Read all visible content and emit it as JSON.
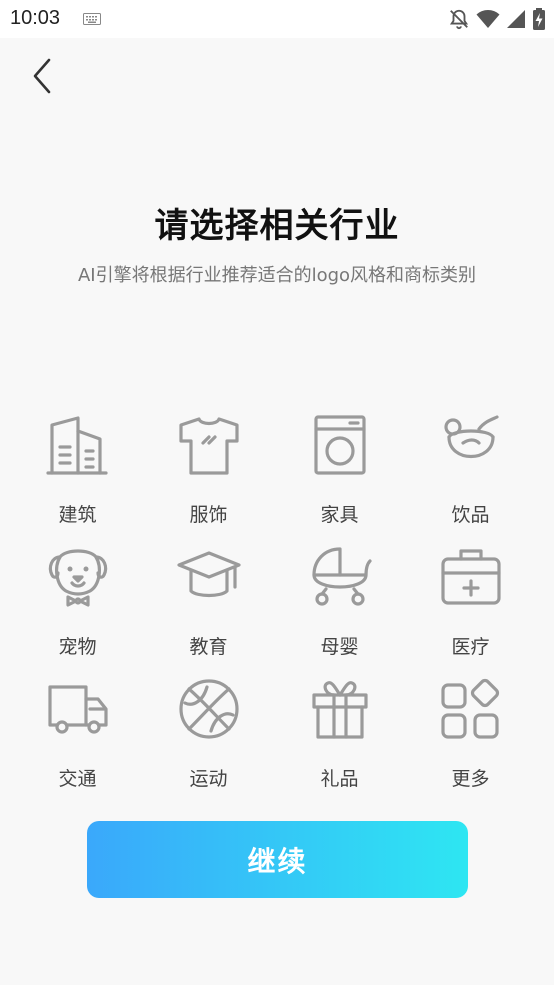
{
  "status_bar": {
    "time": "10:03",
    "icons": [
      "keyboard-icon",
      "bell-off-icon",
      "wifi-icon",
      "cellular-signal-icon",
      "battery-charging-icon"
    ]
  },
  "header": {
    "back_icon": "chevron-left-icon"
  },
  "main": {
    "title": "请选择相关行业",
    "subtitle": "AI引擎将根据行业推荐适合的logo风格和商标类别"
  },
  "industries": [
    {
      "label": "建筑",
      "icon": "building-icon"
    },
    {
      "label": "服饰",
      "icon": "tshirt-icon"
    },
    {
      "label": "家具",
      "icon": "washing-machine-icon"
    },
    {
      "label": "饮品",
      "icon": "drink-cup-icon"
    },
    {
      "label": "宠物",
      "icon": "dog-icon"
    },
    {
      "label": "教育",
      "icon": "graduation-cap-icon"
    },
    {
      "label": "母婴",
      "icon": "baby-stroller-icon"
    },
    {
      "label": "医疗",
      "icon": "medical-kit-icon"
    },
    {
      "label": "交通",
      "icon": "truck-icon"
    },
    {
      "label": "运动",
      "icon": "basketball-icon"
    },
    {
      "label": "礼品",
      "icon": "gift-icon"
    },
    {
      "label": "更多",
      "icon": "more-grid-icon"
    }
  ],
  "continue_button": {
    "label": "继续"
  },
  "colors": {
    "background": "#f8f8f8",
    "icon_gray": "#9a9a9a",
    "gradient_start": "#3aa8fb",
    "gradient_end": "#2ee6f2"
  }
}
